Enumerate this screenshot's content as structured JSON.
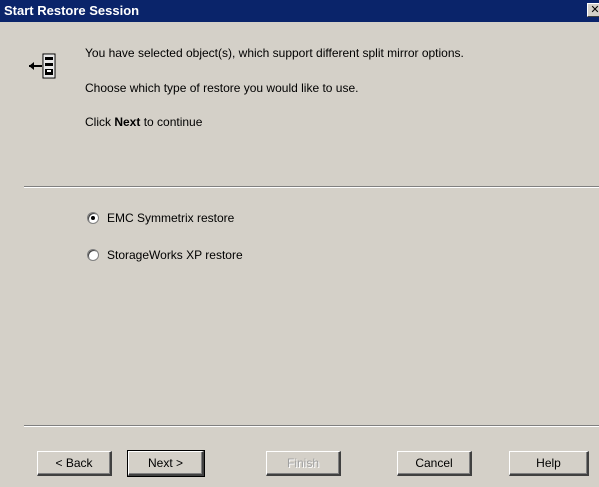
{
  "window": {
    "title": "Start Restore Session",
    "close_glyph": "✕"
  },
  "header": {
    "icon": "restore-arrow-disk-icon",
    "line1": "You have selected object(s), which support different split mirror options.",
    "line2": "Choose which type of restore you would like to use.",
    "line3_pre": "Click ",
    "line3_bold": "Next",
    "line3_post": " to continue"
  },
  "options": [
    {
      "label": "EMC Symmetrix restore",
      "checked": true
    },
    {
      "label": "StorageWorks XP restore",
      "checked": false
    }
  ],
  "buttons": {
    "back": "< Back",
    "next": "Next >",
    "finish": "Finish",
    "cancel": "Cancel",
    "help": "Help"
  }
}
